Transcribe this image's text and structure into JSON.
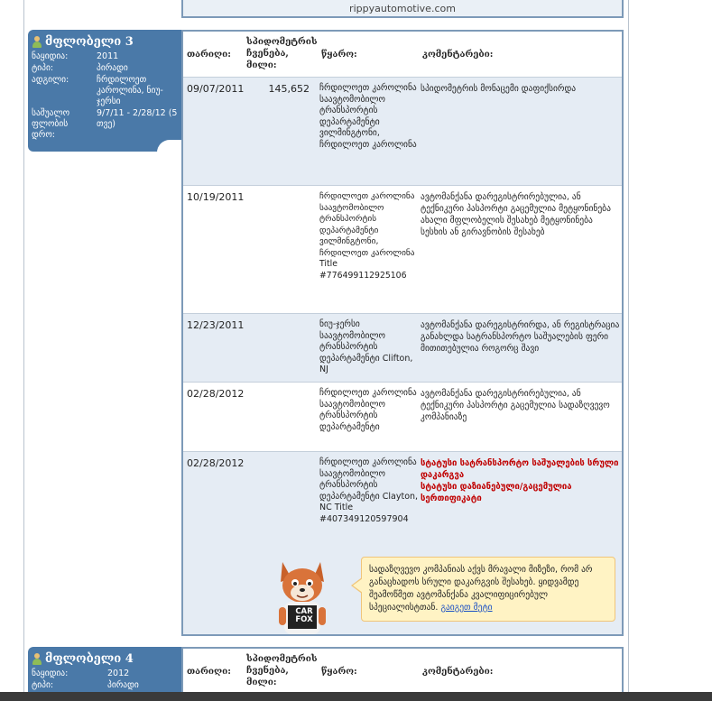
{
  "prev_owner": {
    "url": "rippyautomotive.com"
  },
  "owner3": {
    "title": "მფლობელი 3",
    "fields": [
      {
        "label": "ნაყიდია:",
        "value": "2011"
      },
      {
        "label": "ტიპი:",
        "value": "პირადი"
      },
      {
        "label": "ადგილი:",
        "value": "ჩრდილოეთ კაროლინა, ნიუ-ჯერსი"
      },
      {
        "label": "საშუალო ფლობის დრო:",
        "value": "9/7/11 - 2/28/12 (5 თვე)"
      }
    ],
    "headers": {
      "date": "თარიღი:",
      "odometer": "სპიდომეტრის ჩვენება, მილი:",
      "source": "წყარო:",
      "comments": "კომენტარები:"
    },
    "records": [
      {
        "date": "09/07/2011",
        "odometer": "145,652",
        "source": "ჩრდილოეთ კაროლინა საავტომობილო ტრანსპორტის დეპარტამენტი ვილმინგტონი, ჩრდილოეთ კაროლინა",
        "comments": "სპიდომეტრის მონაცემი დაფიქსირდა",
        "alerts": []
      },
      {
        "date": "10/19/2011",
        "odometer": "",
        "source": "ჩრდილოეთ კაროლინა საავტომობილო ტრანსპორტის დეპარტამენტი ვილმინგტონი, ჩრდილოეთ კაროლინა Title #776499112925106",
        "comments": "ავტომანქანა დარეგისტრირებულია, ან ტექნიკური პასპორტი გაცემულია მეტყონინება ახალი მფლობელის შესახებ მეტყონინება სესხის ან გირავნობის შესახებ",
        "alerts": []
      },
      {
        "date": "12/23/2011",
        "odometer": "",
        "source": "ნიუ-ჯერსი საავტომობილო ტრანსპორტის დეპარტამენტი Clifton, NJ",
        "comments": "ავტომანქანა დარეგისტრირდა, ან რეგისტრაცია განახლდა სატრანსპორტო საშუალების ფერი მითითებულია როგორც შავი",
        "alerts": []
      },
      {
        "date": "02/28/2012",
        "odometer": "",
        "source": "ჩრდილოეთ კაროლინა საავტომობილო ტრანსპორტის დეპარტამენტი",
        "comments": "ავტომანქანა დარეგისტრირებულია, ან ტექნიკური პასპორტი გაცემულია სადაზღვევო კომპანიაზე",
        "alerts": []
      },
      {
        "date": "02/28/2012",
        "odometer": "",
        "source": "ჩრდილოეთ კაროლინა საავტომობილო ტრანსპორტის დეპარტამენტი Clayton, NC Title #407349120597904",
        "comments": "",
        "alerts": [
          "სტატუსი სატრანსპორტო საშუალების სრული დაკარგვა",
          "სტატუსი დაზიანებული/გაცემულია სერთიფიკატი"
        ]
      }
    ],
    "callout": {
      "text": "სადაზღვევო კომპანიას აქვს მრავალი მიზეზი, რომ არ განაცხადოს სრული დაკარგვის შესახებ. ყიდვამდე შეამოწმეთ ავტომანქანა კვალიფიცირებულ სპეციალისტთან.",
      "link": "გაიგეთ მეტი"
    },
    "mascot_sign": "CAR FOX"
  },
  "owner4": {
    "title": "მფლობელი 4",
    "fields": [
      {
        "label": "ნაყიდია:",
        "value": "2012"
      },
      {
        "label": "ტიპი:",
        "value": "პირადი"
      }
    ],
    "headers": {
      "date": "თარიღი:",
      "odometer": "სპიდომეტრის ჩვენება, მილი:",
      "source": "წყარო:",
      "comments": "კომენტარები:"
    }
  },
  "colors": {
    "panel": "#4a79a8",
    "row_shade": "#e5ecf4",
    "alert": "#c00000",
    "callout_bg": "#fff3c4"
  }
}
